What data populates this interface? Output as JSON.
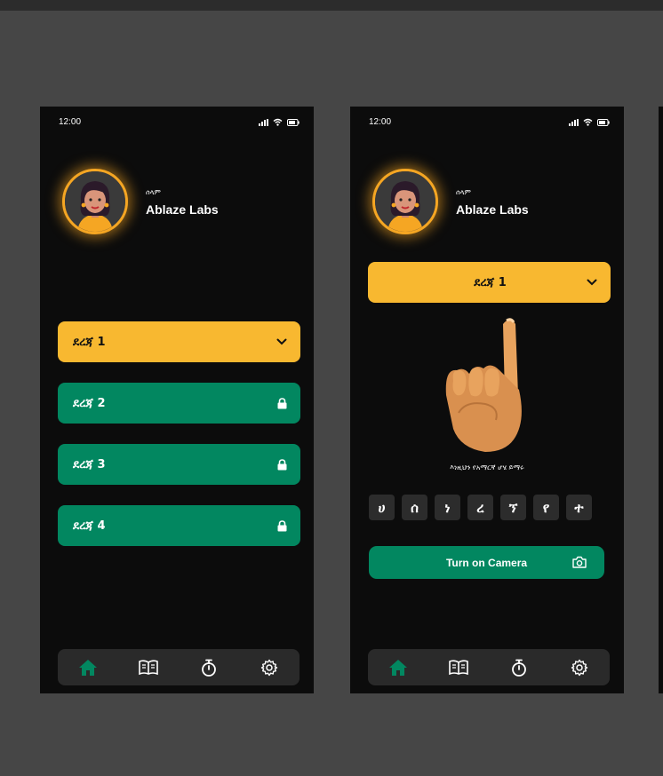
{
  "status": {
    "time": "12:00"
  },
  "profile": {
    "greeting": "ሰላም",
    "name": "Ablaze Labs"
  },
  "levels": [
    {
      "label": "ደረጃ 1",
      "state": "open",
      "icon": "chevron-down-icon"
    },
    {
      "label": "ደረጃ 2",
      "state": "locked",
      "icon": "lock-icon"
    },
    {
      "label": "ደረጃ 3",
      "state": "locked",
      "icon": "lock-icon"
    },
    {
      "label": "ደረጃ 4",
      "state": "locked",
      "icon": "lock-icon"
    }
  ],
  "lesson": {
    "level_label": "ደረጃ 1",
    "instruction": "እነዚህን የአማርኛ ሆሄ ይማሩ",
    "letters": [
      "ሀ",
      "ሰ",
      "ነ",
      "ረ",
      "ኘ",
      "የ",
      "ተ"
    ],
    "camera_button": "Turn on Camera"
  },
  "nav": [
    "home-icon",
    "book-icon",
    "stopwatch-icon",
    "settings-icon"
  ],
  "colors": {
    "accent_yellow": "#f8b830",
    "accent_green": "#028760",
    "background": "#0c0c0c",
    "canvas": "#464646"
  }
}
